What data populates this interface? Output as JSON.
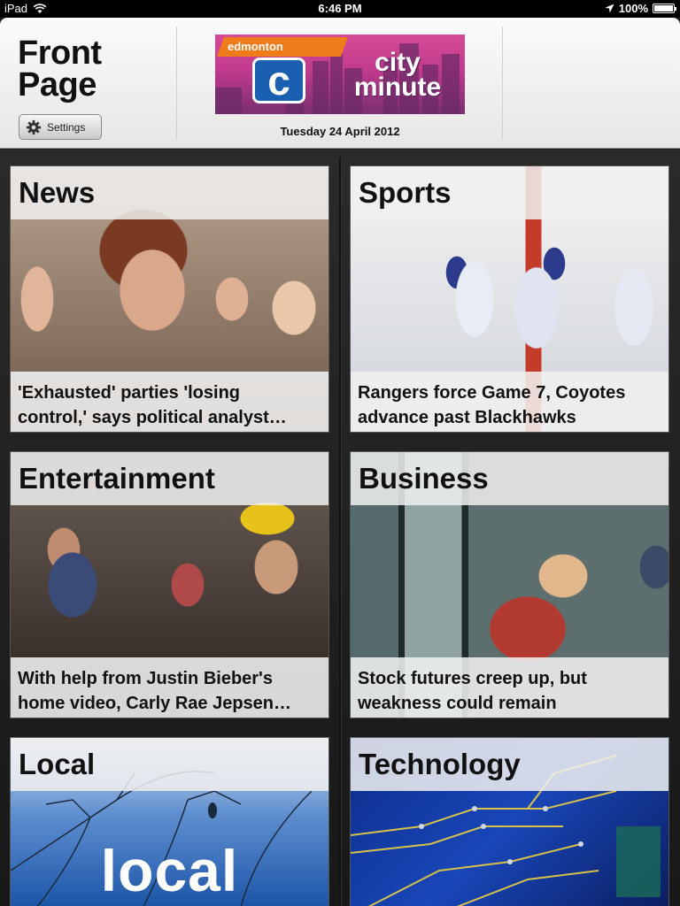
{
  "status": {
    "device": "iPad",
    "time": "6:46 PM",
    "battery": "100%",
    "battery_level": 1.0
  },
  "header": {
    "title_line1": "Front",
    "title_line2": "Page",
    "settings_label": "Settings",
    "logo": {
      "top": "edmonton",
      "c": "c",
      "line1": "city",
      "line2": "minute"
    },
    "date": "Tuesday 24 April 2012"
  },
  "tiles": [
    {
      "category": "News",
      "headline1": "'Exhausted' parties 'losing",
      "headline2": "control,' says political analyst…"
    },
    {
      "category": "Sports",
      "headline1": "Rangers force Game 7, Coyotes",
      "headline2": "advance past Blackhawks"
    },
    {
      "category": "Entertainment",
      "headline1": "With help from Justin Bieber's",
      "headline2": "home video, Carly Rae Jepsen…"
    },
    {
      "category": "Business",
      "headline1": "Stock futures creep up, but",
      "headline2": "weakness could remain"
    },
    {
      "category": "Local",
      "image_text": "local"
    },
    {
      "category": "Technology"
    }
  ],
  "colors": {
    "logo_pink": "#c13a8b",
    "logo_orange": "#f07b1a",
    "logo_blue": "#1b5fb0"
  }
}
